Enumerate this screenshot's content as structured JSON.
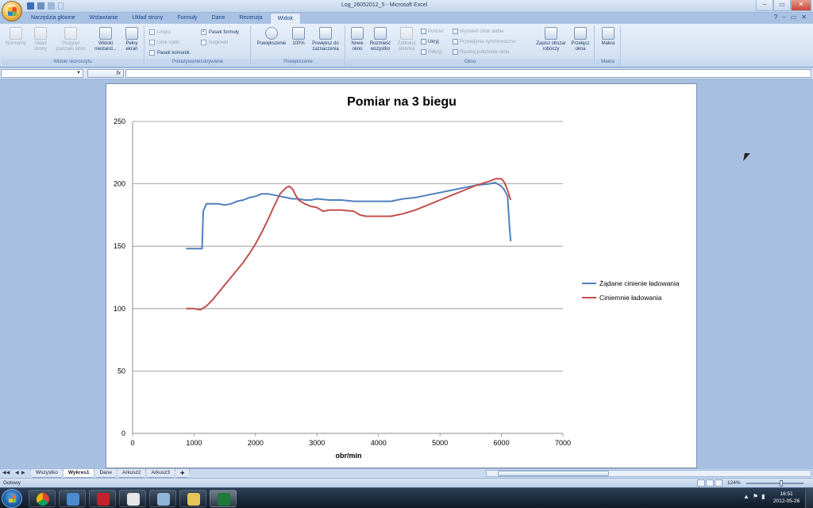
{
  "window": {
    "title": "Log_26052012_5 - Microsoft Excel",
    "minimize": "–",
    "restore": "▭",
    "close": "✕"
  },
  "tabs": [
    {
      "label": "Narzędzia główne"
    },
    {
      "label": "Wstawianie"
    },
    {
      "label": "Układ strony"
    },
    {
      "label": "Formuły"
    },
    {
      "label": "Dane"
    },
    {
      "label": "Recenzja"
    },
    {
      "label": "Widok",
      "active": true
    }
  ],
  "ribbon": {
    "groups": {
      "workbook_views": "Widoki skoroszytu",
      "show_hide": "Pokazywanie/ukrywanie",
      "zoom": "Powiększenie",
      "window": "Okno",
      "macros": "Makra"
    },
    "buttons": {
      "normal": "Normalny",
      "page_layout": "Układ strony",
      "page_break": "Podgląd podziału stron",
      "custom_views": "Widoki niestand...",
      "full_screen": "Pełny ekran",
      "zoom": "Powiększenie",
      "zoom100": "100%",
      "zoom_selection": "Powiększ do zaznaczenia",
      "new_window": "Nowe okno",
      "arrange_all": "Rozmieść wszystko",
      "freeze_panes": "Zablokuj okienka",
      "save_workspace": "Zapisz obszar roboczy",
      "switch_windows": "Przełącz okna",
      "macros": "Makra"
    },
    "checkboxes": {
      "ruler": "Linijka",
      "gridlines": "Linie siatki",
      "message_bar": "Pasek komunik.",
      "formula_bar": "Pasek formuły",
      "headings": "Nagłówki"
    },
    "window_small": {
      "split": "Podziel",
      "hide": "Ukryj",
      "unhide": "Odkryj",
      "side_by_side": "Wyświetl obok siebie",
      "sync_scroll": "Przewijanie synchroniczne",
      "reset_position": "Resetuj położenie okna"
    }
  },
  "formula_bar": {
    "fx": "fx",
    "dropdown": "▼"
  },
  "chart_data": {
    "type": "line",
    "title": "Pomiar na 3 biegu",
    "xlabel": "obr/min",
    "ylabel": "",
    "xlim": [
      0,
      7000
    ],
    "ylim": [
      0,
      250
    ],
    "xticks": [
      0,
      1000,
      2000,
      3000,
      4000,
      5000,
      6000,
      7000
    ],
    "yticks": [
      0,
      50,
      100,
      150,
      200,
      250
    ],
    "grid": true,
    "legend": "right",
    "series": [
      {
        "name": "Żądane cinienie ładowania",
        "color": "#4f81bd",
        "x": [
          870,
          1000,
          1130,
          1150,
          1200,
          1300,
          1400,
          1500,
          1600,
          1700,
          1800,
          1900,
          2000,
          2100,
          2200,
          2300,
          2400,
          2500,
          2600,
          2700,
          2800,
          2900,
          3000,
          3200,
          3400,
          3600,
          3800,
          4000,
          4200,
          4400,
          4600,
          4800,
          5000,
          5200,
          5400,
          5600,
          5800,
          5900,
          6000,
          6050,
          6100,
          6130,
          6150
        ],
        "y": [
          148,
          148,
          148,
          178,
          184,
          184,
          184,
          183,
          184,
          186,
          187,
          189,
          190,
          192,
          192,
          191,
          190,
          189,
          188,
          188,
          187,
          187,
          188,
          187,
          187,
          186,
          186,
          186,
          186,
          188,
          189,
          191,
          193,
          195,
          197,
          199,
          200,
          201,
          198,
          195,
          190,
          167,
          154
        ]
      },
      {
        "name": "Ciniemnie ładowania",
        "color": "#c0504d",
        "x": [
          870,
          1000,
          1100,
          1200,
          1300,
          1400,
          1500,
          1600,
          1700,
          1800,
          1900,
          2000,
          2100,
          2200,
          2300,
          2400,
          2500,
          2550,
          2600,
          2650,
          2700,
          2800,
          2900,
          3000,
          3100,
          3200,
          3400,
          3600,
          3700,
          3800,
          4000,
          4200,
          4400,
          4600,
          4800,
          5000,
          5200,
          5400,
          5600,
          5800,
          5900,
          6000,
          6050,
          6100,
          6150
        ],
        "y": [
          100,
          100,
          99,
          102,
          107,
          113,
          119,
          125,
          131,
          137,
          144,
          152,
          161,
          171,
          182,
          192,
          197,
          198,
          196,
          191,
          187,
          184,
          182,
          181,
          178,
          179,
          179,
          178,
          175,
          174,
          174,
          174,
          176,
          179,
          183,
          187,
          191,
          195,
          199,
          202,
          204,
          204,
          201,
          195,
          187
        ]
      }
    ]
  },
  "sheet_tabs": [
    {
      "label": "Wszystko"
    },
    {
      "label": "Wykres1",
      "active": true
    },
    {
      "label": "Dane"
    },
    {
      "label": "Arkusz2"
    },
    {
      "label": "Arkusz3"
    }
  ],
  "status": {
    "ready": "Gotowy",
    "zoom": "124%"
  },
  "taskbar": {
    "time": "16:51",
    "date": "2012-05-26"
  }
}
